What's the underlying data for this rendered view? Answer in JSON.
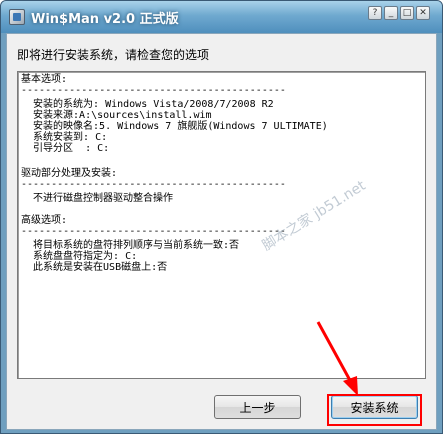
{
  "window": {
    "title": "Win$Man v2.0 正式版",
    "buttons": {
      "help": "?",
      "minimize": "_",
      "maximize": "□",
      "close": "✕"
    }
  },
  "header": {
    "text": "即将进行安装系统，请检查您的选项"
  },
  "summary": {
    "lines": [
      "基本选项:",
      "--------------------------------------------",
      "  安装的系统为: Windows Vista/2008/7/2008 R2",
      "  安装来源:A:\\sources\\install.wim",
      "  安装的映像名:5. Windows 7 旗舰版(Windows 7 ULTIMATE)",
      "  系统安装到: C:",
      "  引导分区  : C:",
      "",
      "驱动部分处理及安装:",
      "--------------------------------------------",
      "  不进行磁盘控制器驱动整合操作",
      "",
      "高级选项:",
      "--------------------------------------------",
      "  将目标系统的盘符排列顺序与当前系统一致:否",
      "  系统盘盘符指定为: C:",
      "  此系统是安装在USB磁盘上:否"
    ]
  },
  "watermark": "脚本之家 jb51.net",
  "footer": {
    "back_label": "上一步",
    "install_label": "安装系统"
  },
  "colors": {
    "titlebar": "#6fa9cf",
    "annotation": "#ff0000"
  }
}
